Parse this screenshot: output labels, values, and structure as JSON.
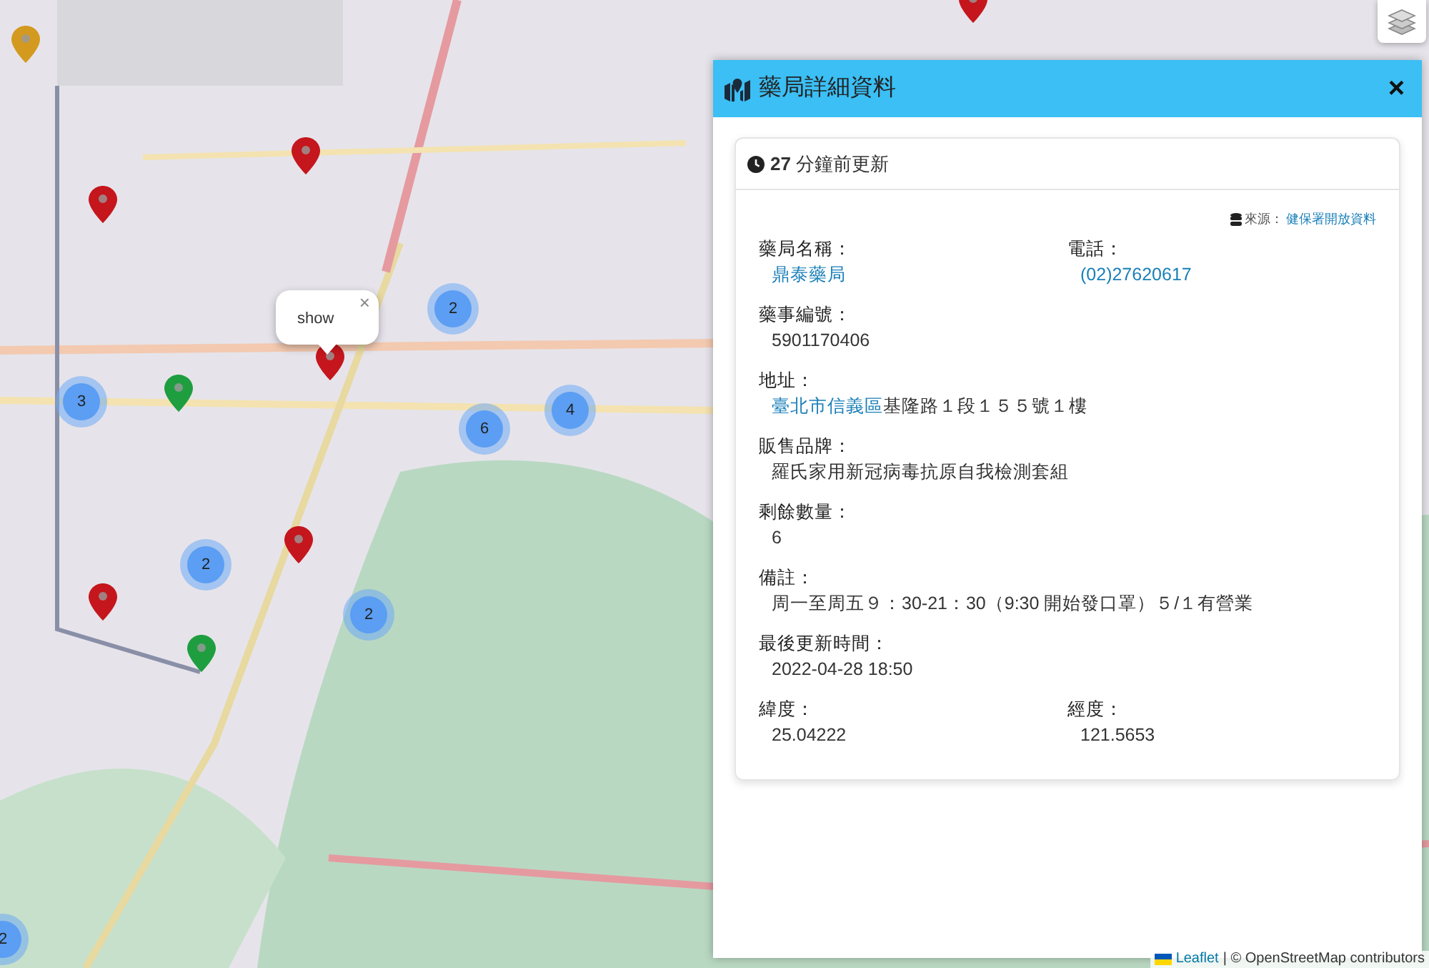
{
  "map": {
    "markers": [
      {
        "kind": "pin",
        "color": "#d39a1f"
      },
      {
        "kind": "pin",
        "color": "#c4161c"
      },
      {
        "kind": "pin",
        "color": "#c4161c"
      },
      {
        "kind": "pin",
        "color": "#c4161c"
      },
      {
        "kind": "pin",
        "color": "#1f9e40"
      },
      {
        "kind": "pin",
        "color": "#c4161c"
      },
      {
        "kind": "pin",
        "color": "#c4161c"
      },
      {
        "kind": "pin",
        "color": "#1f9e40"
      },
      {
        "kind": "pin",
        "color": "#c4161c"
      },
      {
        "kind": "cluster",
        "count": "2"
      },
      {
        "kind": "cluster",
        "count": "3"
      },
      {
        "kind": "cluster",
        "count": "6"
      },
      {
        "kind": "cluster",
        "count": "4"
      },
      {
        "kind": "cluster",
        "count": "2"
      },
      {
        "kind": "cluster",
        "count": "2"
      },
      {
        "kind": "cluster",
        "count": "2"
      }
    ],
    "popup": {
      "text": "show",
      "close": "×"
    },
    "attribution": {
      "leaflet": "Leaflet",
      "rest": "| © OpenStreetMap contributors"
    }
  },
  "panel": {
    "title": "藥局詳細資料",
    "close": "×",
    "updated": {
      "number": "27",
      "text": "分鐘前更新"
    },
    "source": {
      "label": "來源：",
      "link": "健保署開放資料"
    },
    "rows": [
      [
        {
          "label": "藥局名稱：",
          "kind": "link",
          "value": "鼎泰藥局"
        },
        {
          "label": "電話：",
          "kind": "link",
          "value": "(02)27620617"
        }
      ],
      [
        {
          "label": "藥事編號：",
          "kind": "text",
          "value": "5901170406"
        }
      ],
      [
        {
          "label": "地址：",
          "kind": "mixed",
          "link": "臺北市信義區",
          "value": "基隆路１段１５５號１樓"
        }
      ],
      [
        {
          "label": "販售品牌：",
          "kind": "text",
          "value": "羅氏家用新冠病毒抗原自我檢測套組"
        }
      ],
      [
        {
          "label": "剩餘數量：",
          "kind": "text",
          "value": "6"
        }
      ],
      [
        {
          "label": "備註：",
          "kind": "text",
          "value": "周一至周五９：30-21：30（9:30 開始發口罩）５/１有營業"
        }
      ],
      [
        {
          "label": "最後更新時間：",
          "kind": "text",
          "value": "2022-04-28 18:50"
        }
      ],
      [
        {
          "label": "緯度：",
          "kind": "text",
          "value": "25.04222"
        },
        {
          "label": "經度：",
          "kind": "text",
          "value": "121.5653"
        }
      ]
    ]
  }
}
